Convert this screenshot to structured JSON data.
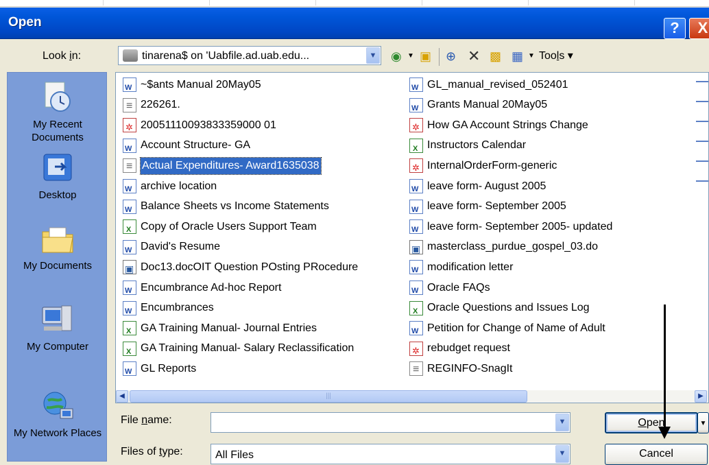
{
  "window": {
    "title": "Open",
    "help": "?",
    "close": "X"
  },
  "look_in": {
    "label_pre": "Look ",
    "label_acc": "i",
    "label_post": "n:",
    "value": "tinarena$ on 'Uabfile.ad.uab.edu..."
  },
  "toolbar": {
    "tools_pre": "Too",
    "tools_acc": "l",
    "tools_post": "s"
  },
  "places": [
    {
      "label": "My Recent Documents",
      "icon": "recent-documents-icon"
    },
    {
      "label": "Desktop",
      "icon": "desktop-icon"
    },
    {
      "label": "My Documents",
      "icon": "my-documents-icon"
    },
    {
      "label": "My Computer",
      "icon": "my-computer-icon"
    },
    {
      "label": "My Network Places",
      "icon": "network-places-icon"
    }
  ],
  "files_col1": [
    {
      "name": "~$ants Manual 20May05",
      "type": "word"
    },
    {
      "name": "226261.",
      "type": "txt"
    },
    {
      "name": "20051110093833359000 01",
      "type": "pdf"
    },
    {
      "name": "Account Structure- GA",
      "type": "word"
    },
    {
      "name": "Actual Expenditures- Award1635038",
      "type": "txt",
      "selected": true
    },
    {
      "name": "archive location",
      "type": "word"
    },
    {
      "name": "Balance Sheets vs Income Statements",
      "type": "word"
    },
    {
      "name": "Copy of Oracle Users Support Team",
      "type": "xls"
    },
    {
      "name": "David's Resume",
      "type": "word"
    },
    {
      "name": "Doc13.docOIT Question POsting PRocedure",
      "type": "doc"
    },
    {
      "name": "Encumbrance Ad-hoc Report",
      "type": "word"
    },
    {
      "name": "Encumbrances",
      "type": "word"
    },
    {
      "name": "GA Training Manual- Journal Entries",
      "type": "xls"
    },
    {
      "name": "GA Training Manual- Salary Reclassification",
      "type": "xls"
    },
    {
      "name": "GL Reports",
      "type": "word"
    }
  ],
  "files_col2": [
    {
      "name": "GL_manual_revised_052401",
      "type": "word"
    },
    {
      "name": "Grants Manual 20May05",
      "type": "word"
    },
    {
      "name": "How GA Account Strings Change",
      "type": "pdf"
    },
    {
      "name": "Instructors Calendar",
      "type": "xls"
    },
    {
      "name": "InternalOrderForm-generic",
      "type": "pdf"
    },
    {
      "name": "leave form- August 2005",
      "type": "word"
    },
    {
      "name": "leave form- September 2005",
      "type": "word"
    },
    {
      "name": "leave form- September 2005- updated",
      "type": "word"
    },
    {
      "name": "masterclass_purdue_gospel_03.do",
      "type": "doc"
    },
    {
      "name": "modification letter",
      "type": "word"
    },
    {
      "name": "Oracle FAQs",
      "type": "word"
    },
    {
      "name": "Oracle Questions and Issues Log",
      "type": "xls"
    },
    {
      "name": "Petition for Change of Name of Adult",
      "type": "word"
    },
    {
      "name": "rebudget request",
      "type": "pdf"
    },
    {
      "name": "REGINFO-SnagIt",
      "type": "txt"
    }
  ],
  "file_name": {
    "label_pre": "File ",
    "label_acc": "n",
    "label_post": "ame:",
    "value": ""
  },
  "file_type": {
    "label_pre": "Files of ",
    "label_acc": "t",
    "label_post": "ype:",
    "value": "All Files"
  },
  "buttons": {
    "open_acc": "O",
    "open_post": "pen",
    "cancel": "Cancel"
  }
}
